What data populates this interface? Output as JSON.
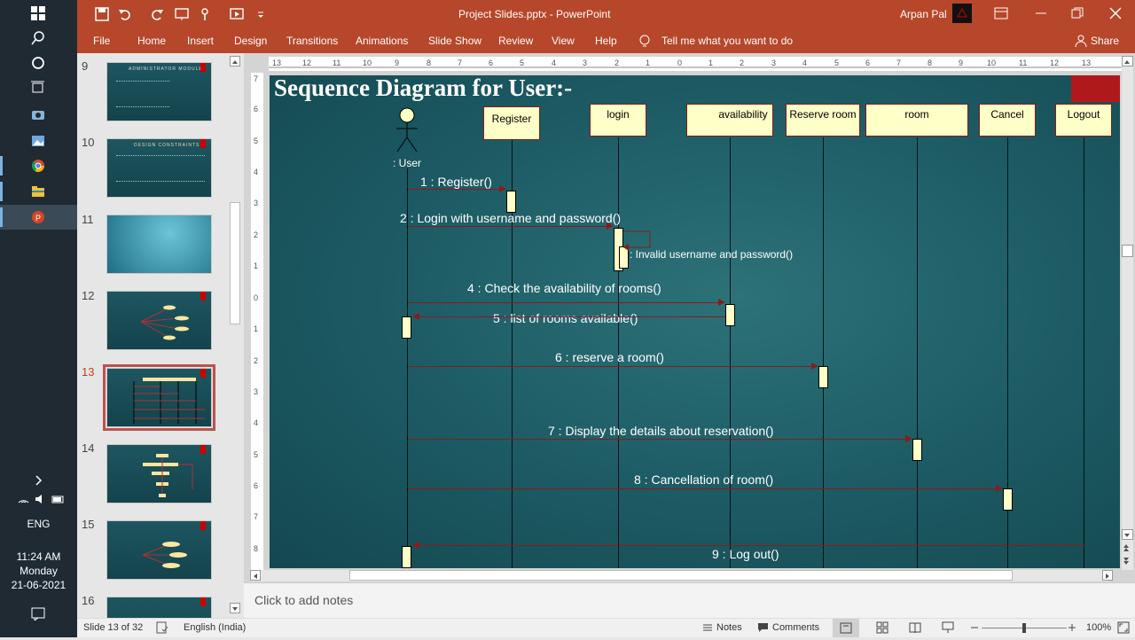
{
  "taskbar": {
    "language": "ENG",
    "time": "11:24 AM",
    "day": "Monday",
    "date": "21-06-2021"
  },
  "window": {
    "title": "Project Slides.pptx  -  PowerPoint",
    "user": "Arpan Pal"
  },
  "ribbon": {
    "tabs": [
      "File",
      "Home",
      "Insert",
      "Design",
      "Transitions",
      "Animations",
      "Slide Show",
      "Review",
      "View",
      "Help"
    ],
    "tell_me": "Tell me what you want to do",
    "share": "Share"
  },
  "thumbnails": [
    {
      "num": "9",
      "title": "ADMINISTRATOR MODULE"
    },
    {
      "num": "10",
      "title": "DESIGN CONSTRAINTS"
    },
    {
      "num": "11",
      "title": ""
    },
    {
      "num": "12",
      "title": ""
    },
    {
      "num": "13",
      "title": ""
    },
    {
      "num": "14",
      "title": ""
    },
    {
      "num": "15",
      "title": ""
    },
    {
      "num": "16",
      "title": ""
    }
  ],
  "selected_slide": "13",
  "slide": {
    "title": "Sequence Diagram for User:-",
    "actor_label": ": User",
    "lifelines": [
      "Register",
      "login",
      "availability",
      "Reserve room",
      "room",
      "Cancel",
      "Logout"
    ],
    "messages": [
      "1 : Register()",
      "2 : Login with username and password()",
      ": Invalid username and password()",
      "4 : Check the availability of rooms()",
      "5 : list of rooms available()",
      "6 : reserve a room()",
      "7 : Display the details about reservation()",
      "8 : Cancellation of room()",
      "9 : Log out()"
    ]
  },
  "notes_placeholder": "Click to add notes",
  "status": {
    "slide_info": "Slide 13 of 32",
    "language": "English (India)",
    "notes": "Notes",
    "comments": "Comments",
    "zoom": "100%"
  },
  "colors": {
    "accent": "#b7472a",
    "slide_bg": "#1c5a63",
    "box_fill": "#ffffc8",
    "arrow": "#8b1a1a"
  }
}
